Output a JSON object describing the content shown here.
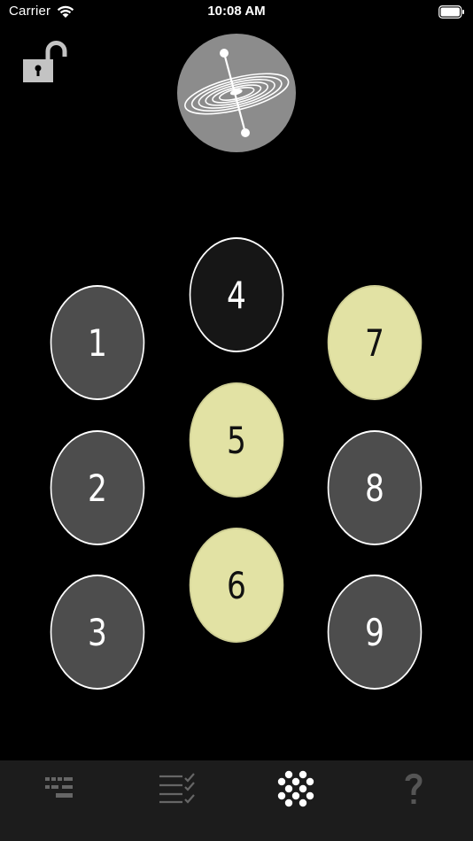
{
  "status_bar": {
    "carrier": "Carrier",
    "time": "10:08 AM"
  },
  "header": {
    "lock_state": "unlocked",
    "logo": "galaxy-spin-icon"
  },
  "buttons": [
    {
      "label": "1",
      "state": "gray"
    },
    {
      "label": "2",
      "state": "gray"
    },
    {
      "label": "3",
      "state": "gray"
    },
    {
      "label": "4",
      "state": "dark"
    },
    {
      "label": "5",
      "state": "yellow"
    },
    {
      "label": "6",
      "state": "yellow"
    },
    {
      "label": "7",
      "state": "yellow"
    },
    {
      "label": "8",
      "state": "gray"
    },
    {
      "label": "9",
      "state": "gray"
    }
  ],
  "tab_bar": {
    "tabs": [
      {
        "icon": "bars-icon",
        "active": false
      },
      {
        "icon": "checklist-icon",
        "active": false
      },
      {
        "icon": "dot-grid-icon",
        "active": true
      },
      {
        "icon": "question-icon",
        "active": false
      }
    ]
  },
  "colors": {
    "background": "#000000",
    "gray": "#4d4d4d",
    "dark": "#161616",
    "yellow": "#e2e2a4",
    "tab_bar": "#1c1c1c"
  }
}
